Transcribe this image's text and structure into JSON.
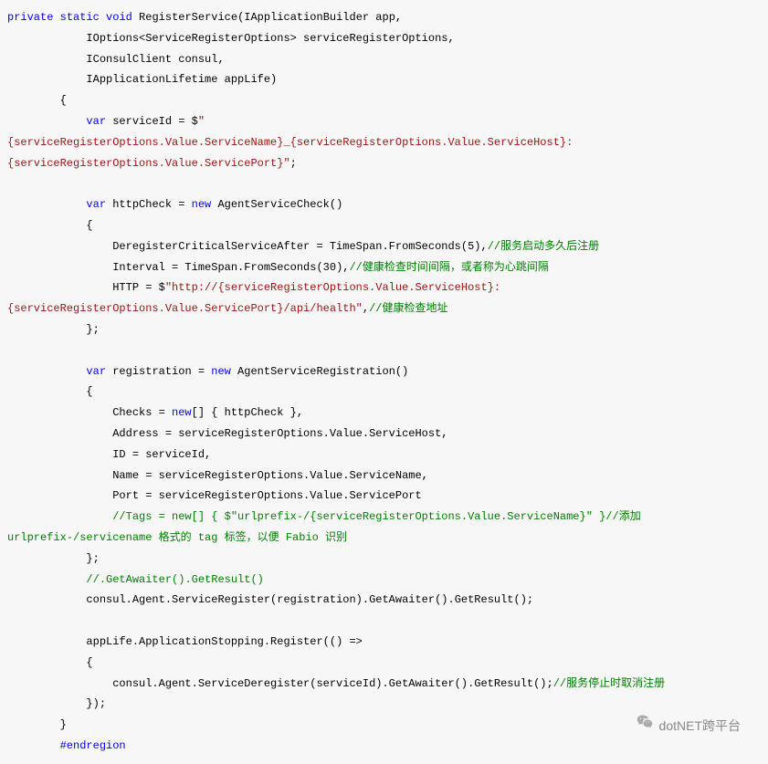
{
  "code": {
    "l1_kw1": "private",
    "l1_kw2": "static",
    "l1_kw3": "void",
    "l1_rest": " RegisterService(IApplicationBuilder app,",
    "l2": "            IOptions<ServiceRegisterOptions> serviceRegisterOptions,",
    "l3": "            IConsulClient consul,",
    "l4": "            IApplicationLifetime appLife)",
    "l5": "        {",
    "l6_indent": "            ",
    "l6_kw": "var",
    "l6_mid": " serviceId = $",
    "l6_str": "\"{serviceRegisterOptions.Value.ServiceName}_{serviceRegisterOptions.Value.ServiceHost}:{serviceRegisterOptions.Value.ServicePort}\"",
    "l6_end": ";",
    "l8_indent": "            ",
    "l8_kw": "var",
    "l8_mid": " httpCheck = ",
    "l8_kw2": "new",
    "l8_rest": " AgentServiceCheck()",
    "l9": "            {",
    "l10_indent": "                DeregisterCriticalServiceAfter = TimeSpan.FromSeconds(",
    "l10_num": "5",
    "l10_mid": "),",
    "l10_cmt": "//服务启动多久后注册",
    "l11_indent": "                Interval = TimeSpan.FromSeconds(",
    "l11_num": "30",
    "l11_mid": "),",
    "l11_cmt": "//健康检查时间间隔，或者称为心跳间隔",
    "l12_indent": "                HTTP = $",
    "l12_str": "\"http://{serviceRegisterOptions.Value.ServiceHost}:{serviceRegisterOptions.Value.ServicePort}/api/health\"",
    "l12_mid": ",",
    "l12_cmt": "//健康检查地址",
    "l13": "            };",
    "l15_indent": "            ",
    "l15_kw": "var",
    "l15_mid": " registration = ",
    "l15_kw2": "new",
    "l15_rest": " AgentServiceRegistration()",
    "l16": "            {",
    "l17_indent": "                Checks = ",
    "l17_kw": "new",
    "l17_rest": "[] { httpCheck },",
    "l18": "                Address = serviceRegisterOptions.Value.ServiceHost,",
    "l19": "                ID = serviceId,",
    "l20": "                Name = serviceRegisterOptions.Value.ServiceName,",
    "l21": "                Port = serviceRegisterOptions.Value.ServicePort",
    "l22_indent": "                ",
    "l22_cmt": "//Tags = new[] { $\"urlprefix-/{serviceRegisterOptions.Value.ServiceName}\" }//添加 urlprefix-/servicename 格式的 tag 标签，以便 Fabio 识别",
    "l23": "            };",
    "l24_indent": "            ",
    "l24_cmt": "//.GetAwaiter().GetResult()",
    "l25": "            consul.Agent.ServiceRegister(registration).GetAwaiter().GetResult();",
    "l27": "            appLife.ApplicationStopping.Register(() =>",
    "l28": "            {",
    "l29_indent": "                consul.Agent.ServiceDeregister(serviceId).GetAwaiter().GetResult();",
    "l29_cmt": "//服务停止时取消注册",
    "l30": "            });",
    "l31": "        }",
    "l32_indent": "        ",
    "l32_region": "#endregion"
  },
  "watermark": {
    "text": "dotNET跨平台"
  }
}
